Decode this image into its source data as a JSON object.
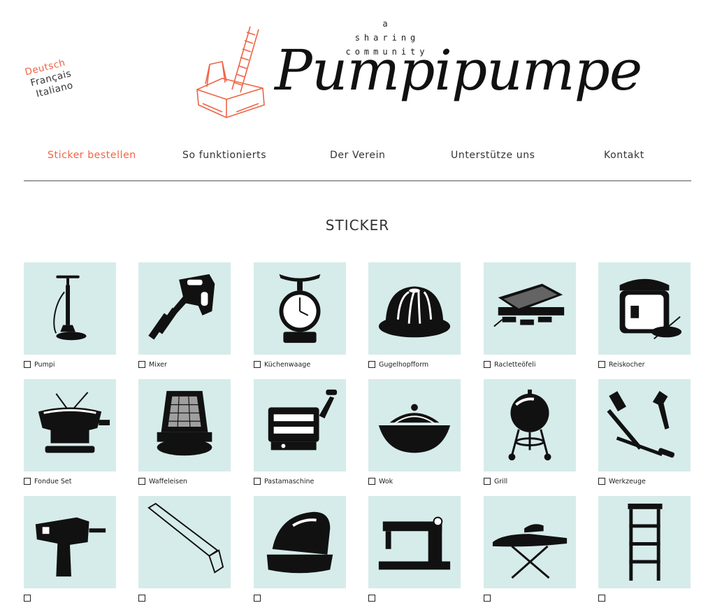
{
  "languages": [
    {
      "label": "Deutsch",
      "active": true
    },
    {
      "label": "Français",
      "active": false
    },
    {
      "label": "Italiano",
      "active": false
    }
  ],
  "brand": {
    "tagline": [
      "a",
      "sharing",
      "community"
    ],
    "name": "Pumpipumpe",
    "accent": "#ee6446",
    "tile_color": "#d6ecea"
  },
  "nav": [
    {
      "label": "Sticker bestellen",
      "active": true
    },
    {
      "label": "So funktionierts",
      "active": false
    },
    {
      "label": "Der Verein",
      "active": false
    },
    {
      "label": "Unterstütze uns",
      "active": false
    },
    {
      "label": "Kontakt",
      "active": false
    }
  ],
  "section_title": "STICKER",
  "stickers": [
    {
      "label": "Pumpi",
      "icon": "bike-pump-icon"
    },
    {
      "label": "Mixer",
      "icon": "hand-mixer-icon"
    },
    {
      "label": "Küchenwaage",
      "icon": "kitchen-scale-icon"
    },
    {
      "label": "Gugelhopfform",
      "icon": "bundt-cake-icon"
    },
    {
      "label": "Racletteöfeli",
      "icon": "raclette-grill-icon"
    },
    {
      "label": "Reiskocher",
      "icon": "rice-cooker-icon"
    },
    {
      "label": "Fondue Set",
      "icon": "fondue-set-icon"
    },
    {
      "label": "Waffeleisen",
      "icon": "waffle-iron-icon"
    },
    {
      "label": "Pastamaschine",
      "icon": "pasta-machine-icon"
    },
    {
      "label": "Wok",
      "icon": "wok-icon"
    },
    {
      "label": "Grill",
      "icon": "kettle-grill-icon"
    },
    {
      "label": "Werkzeuge",
      "icon": "tools-icon"
    },
    {
      "label": "",
      "icon": "power-drill-icon"
    },
    {
      "label": "",
      "icon": "hand-saw-icon"
    },
    {
      "label": "",
      "icon": "clothes-iron-icon"
    },
    {
      "label": "",
      "icon": "sewing-machine-icon"
    },
    {
      "label": "",
      "icon": "ironing-board-icon"
    },
    {
      "label": "",
      "icon": "ladder-icon"
    }
  ]
}
